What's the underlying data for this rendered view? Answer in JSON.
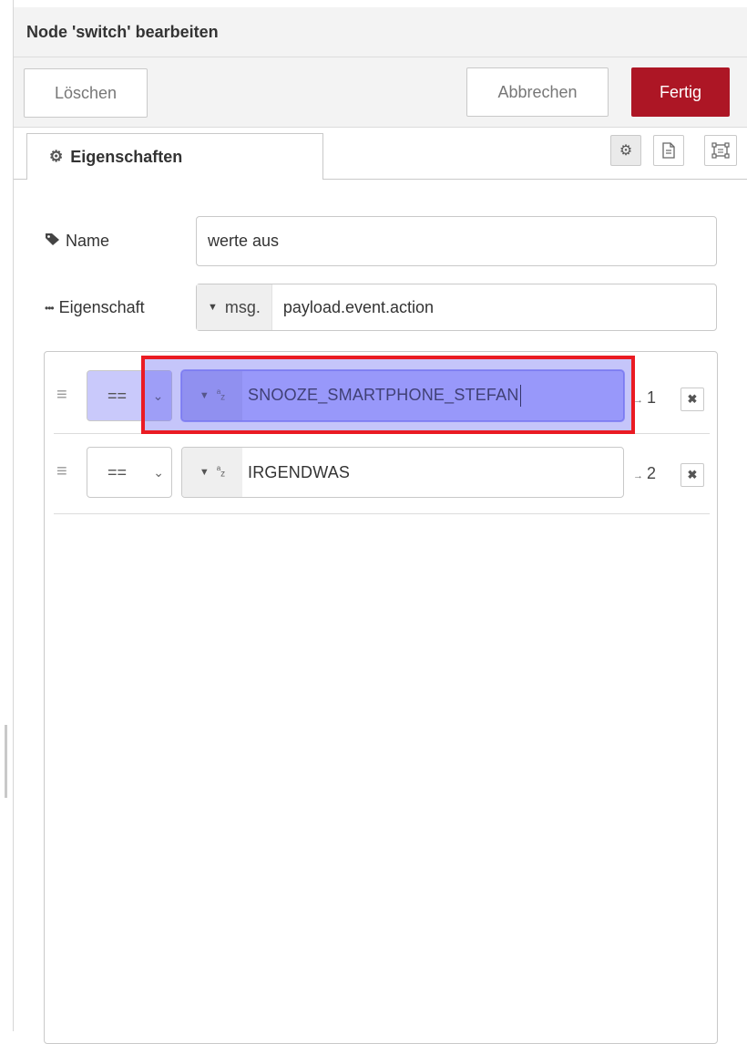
{
  "dialog": {
    "title": "Node 'switch' bearbeiten"
  },
  "toolbar": {
    "delete_label": "Löschen",
    "cancel_label": "Abbrechen",
    "done_label": "Fertig"
  },
  "tabs": {
    "properties_label": "Eigenschaften"
  },
  "form": {
    "name_label": "Name",
    "name_value": "werte aus",
    "property_label": "Eigenschaft",
    "property_type": "msg.",
    "property_value": "payload.event.action"
  },
  "rules": [
    {
      "operator": "==",
      "value": "SNOOZE_SMARTPHONE_STEFAN",
      "output": "1"
    },
    {
      "operator": "==",
      "value": "IRGENDWAS",
      "output": "2"
    }
  ],
  "colors": {
    "done_button": "#ad1625",
    "selection": "#babaff",
    "annotation_box": "#ea1b23"
  },
  "icons": [
    "gear-icon",
    "tag-icon",
    "ellipsis-icon",
    "document-icon",
    "frame-icon",
    "drag-handle-icon",
    "chevron-down-icon",
    "caret-down-icon",
    "string-type-icon",
    "close-icon"
  ]
}
